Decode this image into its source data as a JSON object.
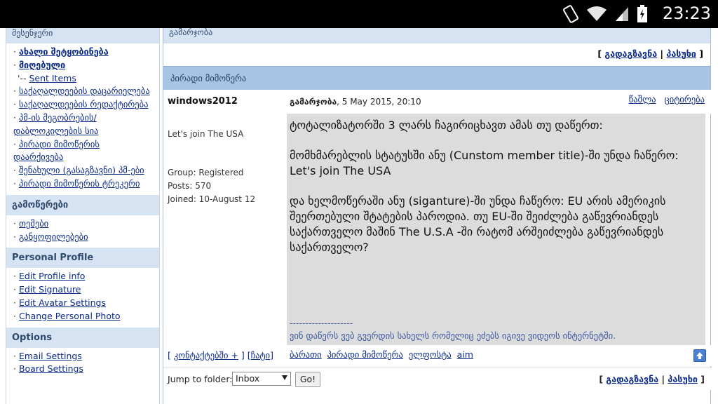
{
  "statusbar": {
    "time": "23:23"
  },
  "sidebar": {
    "head_main": "მესენჯერი",
    "main_items": [
      "ახალი შეტყობინება",
      "მიღებული",
      "Sent Items",
      "საქაღალდეების დაცარიელება",
      "საქაღალდეების რედაქტირება",
      "პმ-ის მეგობრების/ დაბლოკილების სია",
      "პირადი მიმოწერის დაარქივება",
      "შენახული (გასაგზავნი) პმ-ები",
      "პირადი მიმოწერის ტრეკერი"
    ],
    "head_subs": "გამოწერები",
    "subs_items": [
      "თემები",
      "განყოფილებები"
    ],
    "head_profile": "Personal Profile",
    "profile_items": [
      "Edit Profile info",
      "Edit Signature",
      "Edit Avatar Settings",
      "Change Personal Photo"
    ],
    "head_options": "Options",
    "options_items": [
      "Email Settings",
      "Board Settings"
    ]
  },
  "main": {
    "crumb": "გამარჯობა",
    "forward_label": "გადაგზავნა",
    "reply_label": "პასუხი",
    "section_title": "პირადი მიმოწერა",
    "post": {
      "author": "windows2012",
      "greeting": "გამარჯობა",
      "date": ", 5 May 2015, 20:10",
      "delete_label": "წაშლა",
      "quote_label": "ციტირება",
      "member_title": "Let's join The USA",
      "group": "Group: Registered",
      "posts": "Posts: 570",
      "joined": "Joined: 10-August 12",
      "body_1": "ტოტალიზატორში 3 ლარს ჩაგირიცხავთ ამას თუ დაწერთ:",
      "body_2a": "მომხმარებლის სტატუსში ანუ (Cunstom member title)-ში უნდა ჩაწერო:",
      "body_2b": "Let's join The USA",
      "body_3": "და ხელმოწერაში ანუ (siganture)-ში უნდა ჩაწერო: EU არის ამერიკის შეერთებული შტატების პაროდია. თუ EU-ში შეიძლება გაწევრიანდეს საქართველო მაშინ The U.S.A -ში რატომ არშეიძლება გაწევრიანდეს საქართველო?",
      "sig_line": "--------------------",
      "signature": "ვინ დაწერს ვებ გვერდის სახელს რომელიც ეძებს იგივე ვიდეოს ინტერნეტში."
    },
    "foot": {
      "contacts_label": "კონტაქტებში +",
      "chat_label": "ჩატი",
      "links": [
        "ბარათი",
        "პირადი მიმოწერა",
        "ელფოსტა",
        "aim"
      ]
    },
    "jump": {
      "label": "Jump to folder:",
      "selected": "Inbox",
      "go_label": "Go!"
    }
  }
}
